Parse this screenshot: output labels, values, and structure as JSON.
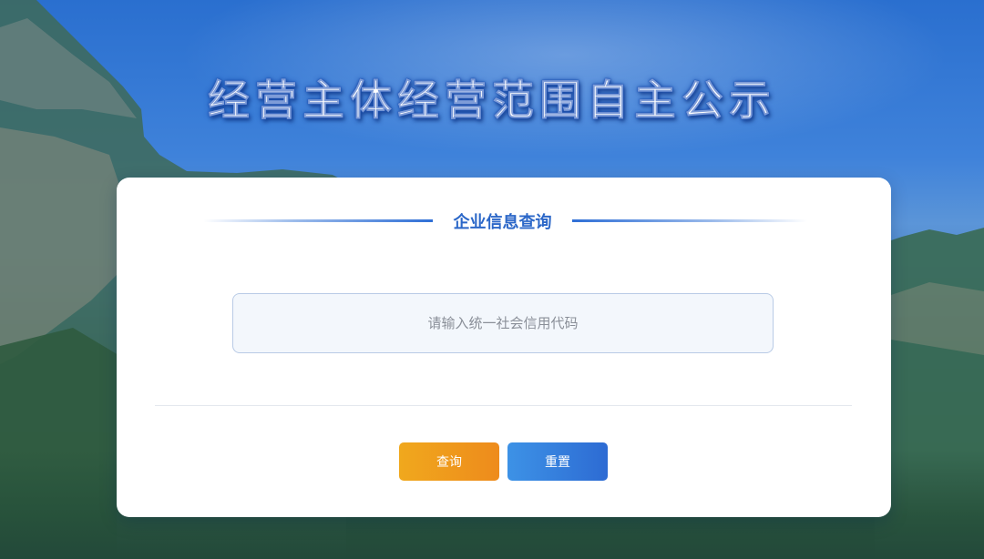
{
  "page": {
    "title": "经营主体经营范围自主公示"
  },
  "card": {
    "section_title": "企业信息查询",
    "search": {
      "placeholder": "请输入统一社会信用代码",
      "value": ""
    },
    "buttons": {
      "query_label": "查询",
      "reset_label": "重置"
    }
  },
  "colors": {
    "accent_blue": "#2b67c8",
    "query_orange": "#ef961d",
    "reset_blue": "#2f6fd6"
  }
}
